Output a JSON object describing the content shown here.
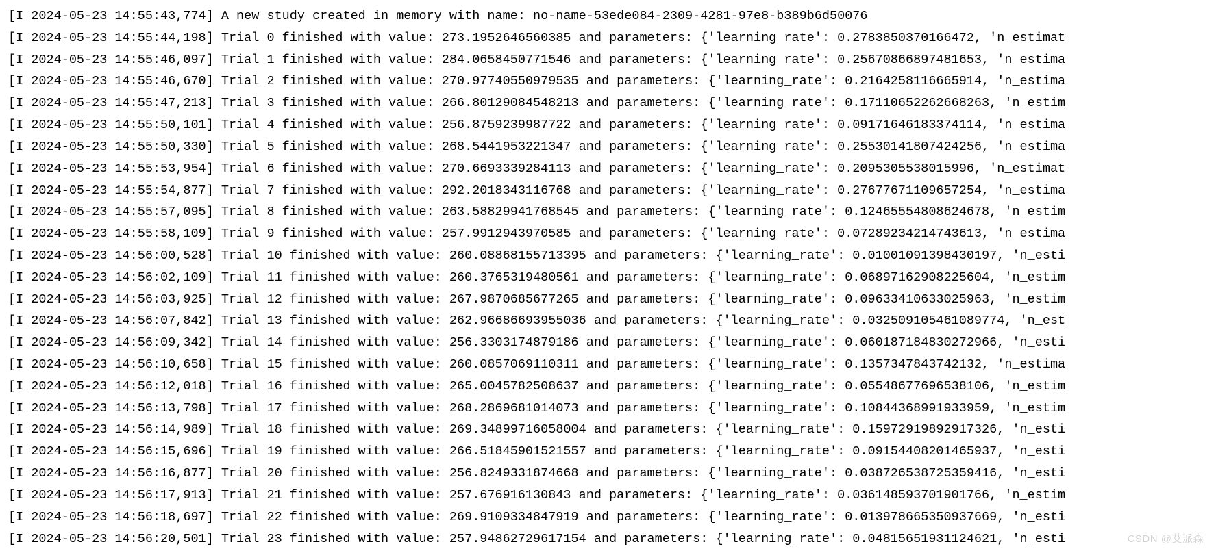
{
  "watermark": "CSDN @艾派森",
  "header_line": "[I 2024-05-23 14:55:43,774] A new study created in memory with name: no-name-53ede084-2309-4281-97e8-b389b6d50076",
  "prefix_level": "I",
  "param_key1": "learning_rate",
  "param_key2_truncated_variants": "see trials.tail",
  "trials": [
    {
      "ts": "2024-05-23 14:55:44,198",
      "n": 0,
      "value": "273.1952646560385",
      "lr": "0.2783850370166472",
      "tail": "'n_estimat"
    },
    {
      "ts": "2024-05-23 14:55:46,097",
      "n": 1,
      "value": "284.0658450771546",
      "lr": "0.25670866897481653",
      "tail": "'n_estima"
    },
    {
      "ts": "2024-05-23 14:55:46,670",
      "n": 2,
      "value": "270.97740550979535",
      "lr": "0.2164258116665914",
      "tail": "'n_estima"
    },
    {
      "ts": "2024-05-23 14:55:47,213",
      "n": 3,
      "value": "266.80129084548213",
      "lr": "0.17110652262668263",
      "tail": "'n_estim"
    },
    {
      "ts": "2024-05-23 14:55:50,101",
      "n": 4,
      "value": "256.8759239987722",
      "lr": "0.09171646183374114",
      "tail": "'n_estima"
    },
    {
      "ts": "2024-05-23 14:55:50,330",
      "n": 5,
      "value": "268.5441953221347",
      "lr": "0.25530141807424256",
      "tail": "'n_estima"
    },
    {
      "ts": "2024-05-23 14:55:53,954",
      "n": 6,
      "value": "270.6693339284113",
      "lr": "0.2095305538015996",
      "tail": "'n_estimat"
    },
    {
      "ts": "2024-05-23 14:55:54,877",
      "n": 7,
      "value": "292.2018343116768",
      "lr": "0.27677671109657254",
      "tail": "'n_estima"
    },
    {
      "ts": "2024-05-23 14:55:57,095",
      "n": 8,
      "value": "263.58829941768545",
      "lr": "0.12465554808624678",
      "tail": "'n_estim"
    },
    {
      "ts": "2024-05-23 14:55:58,109",
      "n": 9,
      "value": "257.9912943970585",
      "lr": "0.07289234214743613",
      "tail": "'n_estima"
    },
    {
      "ts": "2024-05-23 14:56:00,528",
      "n": 10,
      "value": "260.08868155713395",
      "lr": "0.01001091398430197",
      "tail": "'n_esti"
    },
    {
      "ts": "2024-05-23 14:56:02,109",
      "n": 11,
      "value": "260.3765319480561",
      "lr": "0.06897162908225604",
      "tail": "'n_estim"
    },
    {
      "ts": "2024-05-23 14:56:03,925",
      "n": 12,
      "value": "267.9870685677265",
      "lr": "0.09633410633025963",
      "tail": "'n_estim"
    },
    {
      "ts": "2024-05-23 14:56:07,842",
      "n": 13,
      "value": "262.96686693955036",
      "lr": "0.032509105461089774",
      "tail": "'n_est"
    },
    {
      "ts": "2024-05-23 14:56:09,342",
      "n": 14,
      "value": "256.3303174879186",
      "lr": "0.060187184830272966",
      "tail": "'n_esti"
    },
    {
      "ts": "2024-05-23 14:56:10,658",
      "n": 15,
      "value": "260.0857069110311",
      "lr": "0.1357347843742132",
      "tail": "'n_estima"
    },
    {
      "ts": "2024-05-23 14:56:12,018",
      "n": 16,
      "value": "265.0045782508637",
      "lr": "0.05548677696538106",
      "tail": "'n_estim"
    },
    {
      "ts": "2024-05-23 14:56:13,798",
      "n": 17,
      "value": "268.2869681014073",
      "lr": "0.10844368991933959",
      "tail": "'n_estim"
    },
    {
      "ts": "2024-05-23 14:56:14,989",
      "n": 18,
      "value": "269.34899716058004",
      "lr": "0.15972919892917326",
      "tail": "'n_esti"
    },
    {
      "ts": "2024-05-23 14:56:15,696",
      "n": 19,
      "value": "266.51845901521557",
      "lr": "0.09154408201465937",
      "tail": "'n_esti"
    },
    {
      "ts": "2024-05-23 14:56:16,877",
      "n": 20,
      "value": "256.8249331874668",
      "lr": "0.038726538725359416",
      "tail": "'n_esti"
    },
    {
      "ts": "2024-05-23 14:56:17,913",
      "n": 21,
      "value": "257.676916130843",
      "lr": "0.036148593701901766",
      "tail": "'n_estim"
    },
    {
      "ts": "2024-05-23 14:56:18,697",
      "n": 22,
      "value": "269.9109334847919",
      "lr": "0.013978665350937669",
      "tail": "'n_esti"
    },
    {
      "ts": "2024-05-23 14:56:20,501",
      "n": 23,
      "value": "257.94862729617154",
      "lr": "0.04815651931124621",
      "tail": "'n_esti"
    }
  ]
}
